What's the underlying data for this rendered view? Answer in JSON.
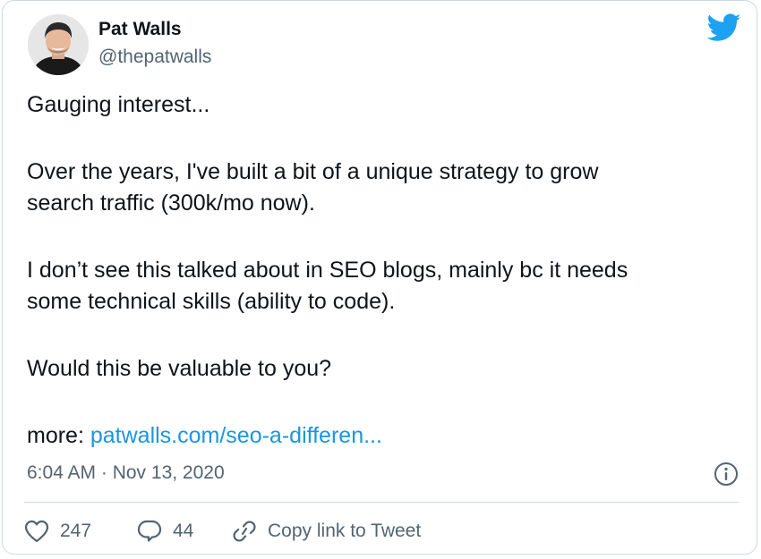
{
  "author": {
    "name": "Pat Walls",
    "handle": "@thepatwalls",
    "avatar_icon": "profile-photo"
  },
  "brand_icon": "twitter-bird-icon",
  "tweet": {
    "lines": [
      "Gauging interest...",
      "Over the years, I've built a bit of a unique strategy to grow",
      "search traffic (300k/mo now).",
      "I don’t see this talked about in SEO blogs, mainly bc it needs",
      "some technical skills (ability to code).",
      "Would this be valuable to you?"
    ],
    "more_prefix": "more: ",
    "more_link": "patwalls.com/seo-a-differen..."
  },
  "timestamp": "6:04 AM · Nov 13, 2020",
  "actions": {
    "likes": "247",
    "replies": "44",
    "copy_link_label": "Copy link to Tweet"
  },
  "colors": {
    "twitter_blue": "#1da1f2",
    "link_blue": "#1b95e0",
    "text": "#0f1419",
    "secondary": "#536471",
    "border": "#cfd9de"
  }
}
